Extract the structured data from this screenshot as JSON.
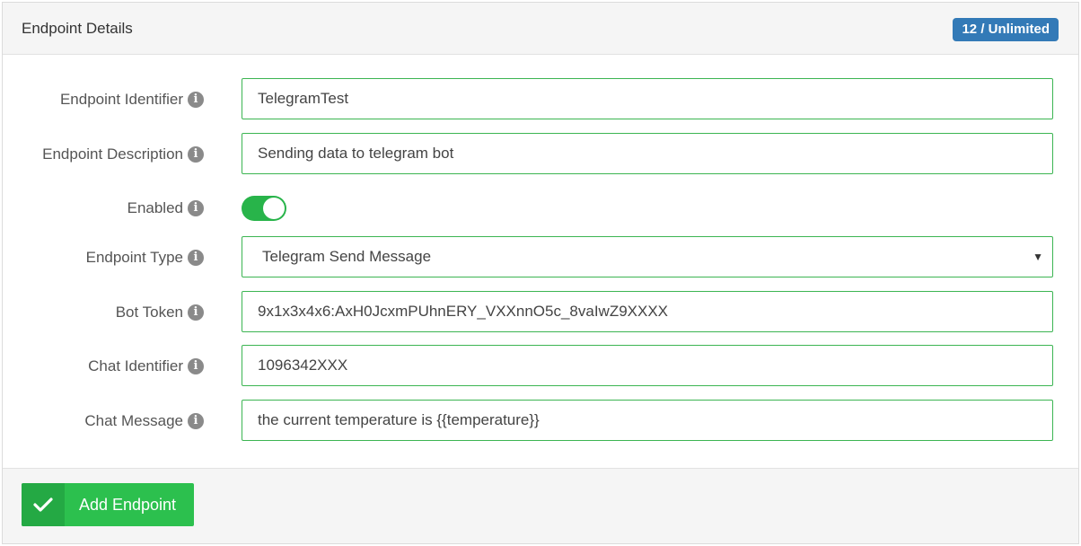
{
  "panel": {
    "title": "Endpoint Details",
    "quota_badge": "12 / Unlimited"
  },
  "fields": {
    "identifier": {
      "label": "Endpoint Identifier",
      "value": "TelegramTest"
    },
    "description": {
      "label": "Endpoint Description",
      "value": "Sending data to telegram bot"
    },
    "enabled": {
      "label": "Enabled",
      "value": true
    },
    "type": {
      "label": "Endpoint Type",
      "value": "Telegram Send Message"
    },
    "bot_token": {
      "label": "Bot Token",
      "value": "9x1x3x4x6:AxH0JcxmPUhnERY_VXXnnO5c_8vaIwZ9XXXX"
    },
    "chat_id": {
      "label": "Chat Identifier",
      "value": "1096342XXX"
    },
    "chat_message": {
      "label": "Chat Message",
      "value": "the current temperature is {{temperature}}"
    }
  },
  "footer": {
    "add_button_label": "Add Endpoint"
  },
  "icons": {
    "info": "info-icon",
    "check": "check-icon",
    "dropdown": "caret-down-icon"
  },
  "colors": {
    "accent_green": "#2cc04e",
    "input_border": "#3cb552",
    "badge_blue": "#337ab7"
  }
}
